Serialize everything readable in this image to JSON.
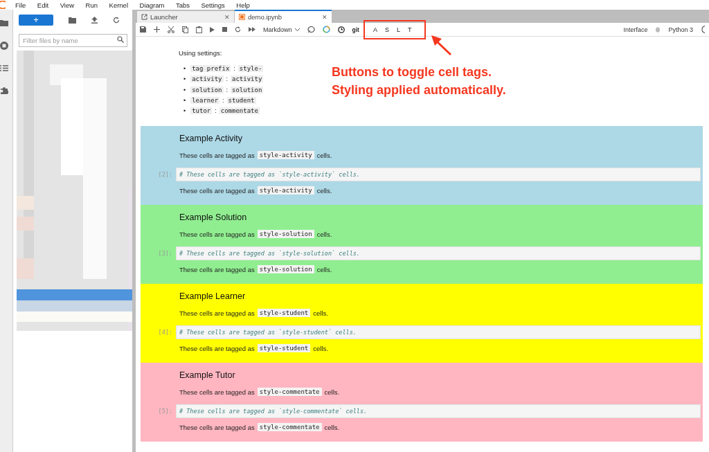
{
  "menu": [
    "File",
    "Edit",
    "View",
    "Run",
    "Kernel",
    "Diagram",
    "Tabs",
    "Settings",
    "Help"
  ],
  "filebrowser": {
    "placeholder": "Filter files by name",
    "new_label": "+"
  },
  "tabs": [
    {
      "label": "Launcher",
      "selected": false,
      "close": "✕"
    },
    {
      "label": "demo.ipynb",
      "selected": true,
      "close": "✕"
    }
  ],
  "toolbar": {
    "cell_type": "Markdown",
    "git": "git",
    "tag_buttons": [
      "A",
      "S",
      "L",
      "T"
    ],
    "interface": "Interface",
    "kernel": "Python 3"
  },
  "intro": {
    "text": "Using settings:",
    "settings": [
      {
        "bullet": "•",
        "key": "tag prefix",
        "sep": ":",
        "value": "style-"
      },
      {
        "bullet": "•",
        "key": "activity",
        "sep": ":",
        "value": "activity"
      },
      {
        "bullet": "•",
        "key": "solution",
        "sep": ":",
        "value": "solution"
      },
      {
        "bullet": "•",
        "key": "learner",
        "sep": ":",
        "value": "student"
      },
      {
        "bullet": "•",
        "key": "tutor",
        "sep": ":",
        "value": "commentate"
      }
    ]
  },
  "sections": [
    {
      "heading": "Example Activity",
      "color": "#add8e6",
      "pre": "These cells are tagged as",
      "tag": "style-activity",
      "post": "cells.",
      "prompt": "[2]:",
      "code": "# These cells are tagged as `style-activity` cells.",
      "pre2": "These cells are tagged as",
      "tag2": "style-activity",
      "post2": "cells."
    },
    {
      "heading": "Example Solution",
      "color": "#90ee90",
      "pre": "These cells are tagged as",
      "tag": "style-solution",
      "post": "cells.",
      "prompt": "[3]:",
      "code": "# These cells are tagged as `style-solution` cells.",
      "pre2": "These cells are tagged as",
      "tag2": "style-solution",
      "post2": "cells."
    },
    {
      "heading": "Example Learner",
      "color": "#ffff00",
      "pre": "These cells are tagged as",
      "tag": "style-student",
      "post": "cells.",
      "prompt": "[4]:",
      "code": "# These cells are tagged as `style-student` cells.",
      "pre2": "These cells are tagged as",
      "tag2": "style-student",
      "post2": "cells."
    },
    {
      "heading": "Example Tutor",
      "color": "#ffb6c1",
      "pre": "These cells are tagged as",
      "tag": "style-commentate",
      "post": "cells.",
      "prompt": "[5]:",
      "code": "# These cells are tagged as `style-commentate` cells.",
      "pre2": "These cells are tagged as",
      "tag2": "style-commentate",
      "post2": "cells."
    }
  ],
  "annotation": [
    "Buttons to toggle cell tags.",
    "Styling applied automatically."
  ]
}
